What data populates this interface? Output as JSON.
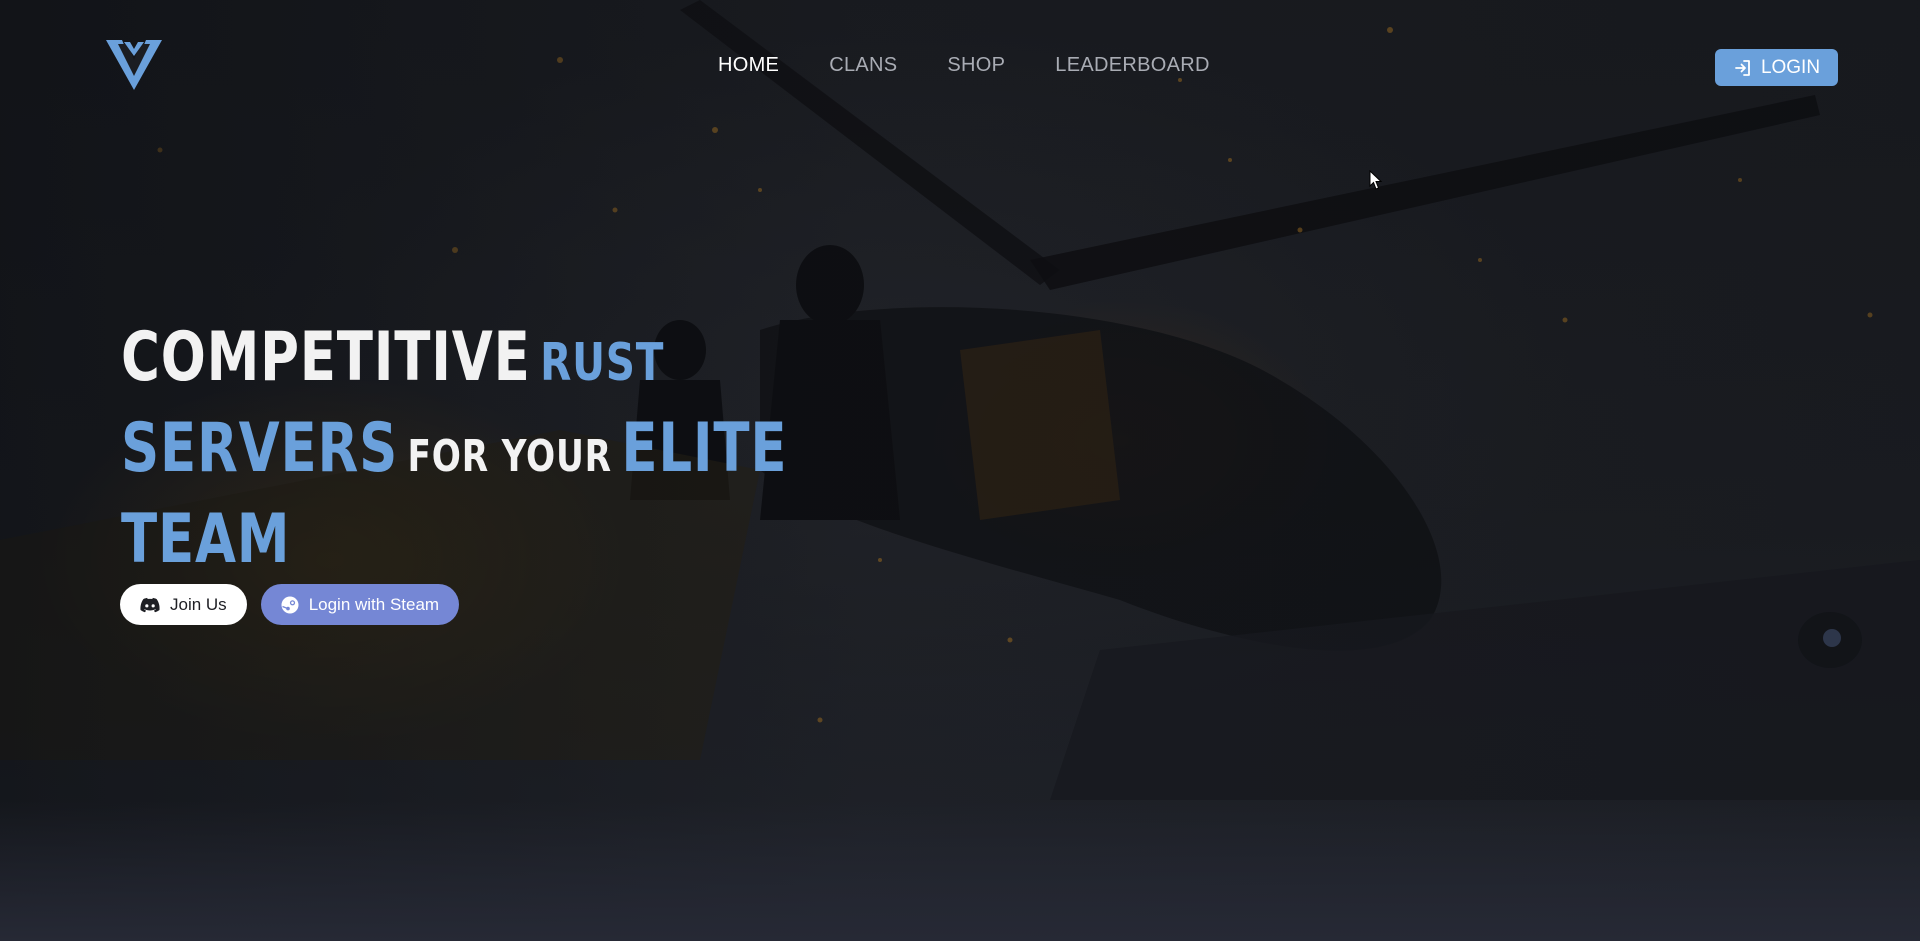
{
  "nav": {
    "items": [
      {
        "label": "HOME",
        "active": true
      },
      {
        "label": "CLANS",
        "active": false
      },
      {
        "label": "SHOP",
        "active": false
      },
      {
        "label": "LEADERBOARD",
        "active": false
      }
    ],
    "login_label": "LOGIN"
  },
  "hero": {
    "title": {
      "competitive": "COMPETITIVE",
      "rust": "RUST",
      "servers": "SERVERS",
      "for_your": "FOR YOUR",
      "elite": "ELITE",
      "team": "TEAM"
    },
    "join_label": "Join Us",
    "steam_label": "Login with Steam"
  },
  "icons": {
    "logo": "brand-logo-icon",
    "login": "login-arrow-icon",
    "discord": "discord-icon",
    "steam": "steam-icon"
  },
  "colors": {
    "accent": "#6aa0db",
    "steam_button": "#7587d5",
    "background": "#1b1d22"
  }
}
